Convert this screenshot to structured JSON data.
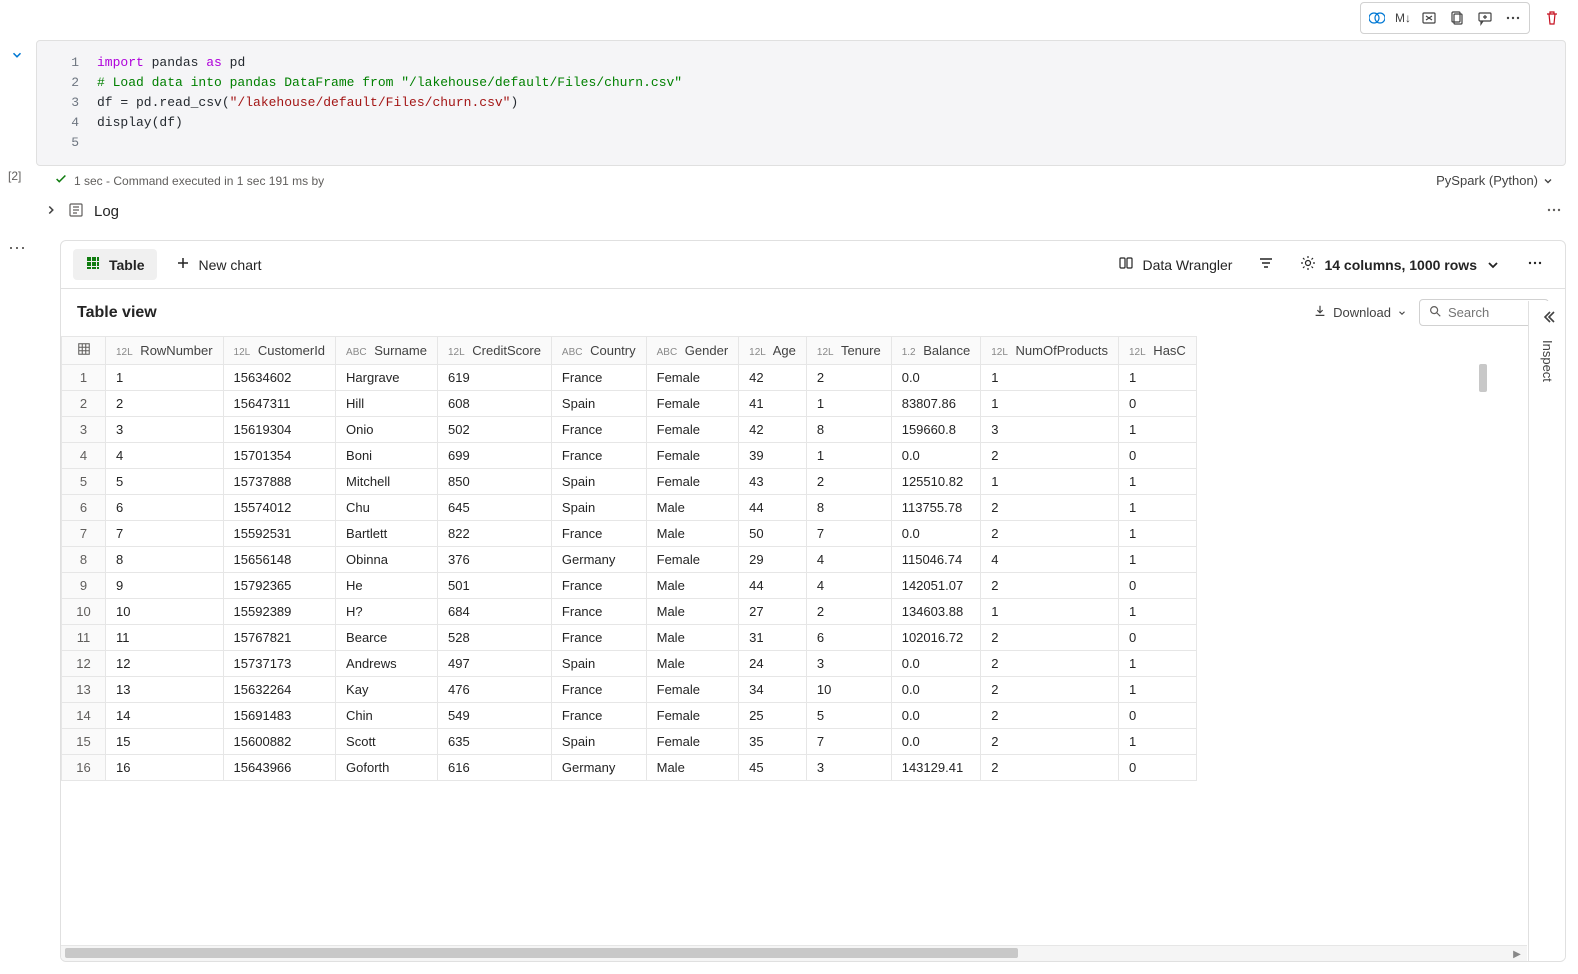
{
  "toolbar": {
    "markdown_label": "M↓"
  },
  "code": {
    "line_numbers": [
      "1",
      "2",
      "3",
      "4",
      "5"
    ],
    "l1_import": "import",
    "l1_pandas": " pandas ",
    "l1_as": "as",
    "l1_pd": " pd",
    "l2": "# Load data into pandas DataFrame from \"/lakehouse/default/Files/churn.csv\"",
    "l3_a": "df = pd.read_csv(",
    "l3_s": "\"/lakehouse/default/Files/churn.csv\"",
    "l3_b": ")",
    "l4_a": "display(df)",
    "l5": ""
  },
  "exec": {
    "count": "[2]",
    "time": "1 sec",
    "sep": " - ",
    "msg": "Command executed in 1 sec 191 ms by",
    "kernel": "PySpark (Python)"
  },
  "log": {
    "label": "Log"
  },
  "output": {
    "tab_table": "Table",
    "tab_chart": "New chart",
    "data_wrangler": "Data Wrangler",
    "columns_info": "14 columns, 1000 rows",
    "table_view": "Table view",
    "download": "Download",
    "search_placeholder": "Search",
    "inspect": "Inspect"
  },
  "columns": [
    {
      "type": "",
      "name": ""
    },
    {
      "type": "12L",
      "name": "RowNumber"
    },
    {
      "type": "12L",
      "name": "CustomerId"
    },
    {
      "type": "ABC",
      "name": "Surname"
    },
    {
      "type": "12L",
      "name": "CreditScore"
    },
    {
      "type": "ABC",
      "name": "Country"
    },
    {
      "type": "ABC",
      "name": "Gender"
    },
    {
      "type": "12L",
      "name": "Age"
    },
    {
      "type": "12L",
      "name": "Tenure"
    },
    {
      "type": "1.2",
      "name": "Balance"
    },
    {
      "type": "12L",
      "name": "NumOfProducts"
    },
    {
      "type": "12L",
      "name": "HasC"
    }
  ],
  "rows": [
    [
      "1",
      "1",
      "15634602",
      "Hargrave",
      "619",
      "France",
      "Female",
      "42",
      "2",
      "0.0",
      "1",
      "1"
    ],
    [
      "2",
      "2",
      "15647311",
      "Hill",
      "608",
      "Spain",
      "Female",
      "41",
      "1",
      "83807.86",
      "1",
      "0"
    ],
    [
      "3",
      "3",
      "15619304",
      "Onio",
      "502",
      "France",
      "Female",
      "42",
      "8",
      "159660.8",
      "3",
      "1"
    ],
    [
      "4",
      "4",
      "15701354",
      "Boni",
      "699",
      "France",
      "Female",
      "39",
      "1",
      "0.0",
      "2",
      "0"
    ],
    [
      "5",
      "5",
      "15737888",
      "Mitchell",
      "850",
      "Spain",
      "Female",
      "43",
      "2",
      "125510.82",
      "1",
      "1"
    ],
    [
      "6",
      "6",
      "15574012",
      "Chu",
      "645",
      "Spain",
      "Male",
      "44",
      "8",
      "113755.78",
      "2",
      "1"
    ],
    [
      "7",
      "7",
      "15592531",
      "Bartlett",
      "822",
      "France",
      "Male",
      "50",
      "7",
      "0.0",
      "2",
      "1"
    ],
    [
      "8",
      "8",
      "15656148",
      "Obinna",
      "376",
      "Germany",
      "Female",
      "29",
      "4",
      "115046.74",
      "4",
      "1"
    ],
    [
      "9",
      "9",
      "15792365",
      "He",
      "501",
      "France",
      "Male",
      "44",
      "4",
      "142051.07",
      "2",
      "0"
    ],
    [
      "10",
      "10",
      "15592389",
      "H?",
      "684",
      "France",
      "Male",
      "27",
      "2",
      "134603.88",
      "1",
      "1"
    ],
    [
      "11",
      "11",
      "15767821",
      "Bearce",
      "528",
      "France",
      "Male",
      "31",
      "6",
      "102016.72",
      "2",
      "0"
    ],
    [
      "12",
      "12",
      "15737173",
      "Andrews",
      "497",
      "Spain",
      "Male",
      "24",
      "3",
      "0.0",
      "2",
      "1"
    ],
    [
      "13",
      "13",
      "15632264",
      "Kay",
      "476",
      "France",
      "Female",
      "34",
      "10",
      "0.0",
      "2",
      "1"
    ],
    [
      "14",
      "14",
      "15691483",
      "Chin",
      "549",
      "France",
      "Female",
      "25",
      "5",
      "0.0",
      "2",
      "0"
    ],
    [
      "15",
      "15",
      "15600882",
      "Scott",
      "635",
      "Spain",
      "Female",
      "35",
      "7",
      "0.0",
      "2",
      "1"
    ],
    [
      "16",
      "16",
      "15643966",
      "Goforth",
      "616",
      "Germany",
      "Male",
      "45",
      "3",
      "143129.41",
      "2",
      "0"
    ]
  ]
}
